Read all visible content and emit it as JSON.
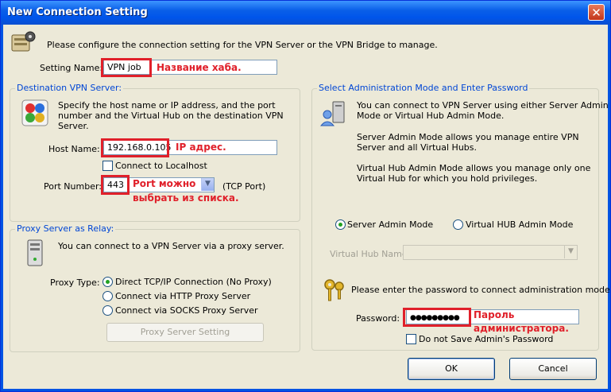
{
  "window": {
    "title": "New Connection Setting",
    "close_glyph": "✕"
  },
  "intro": {
    "text": "Please configure the connection setting for the VPN Server or the VPN Bridge to manage."
  },
  "setting_name": {
    "label": "Setting Name:",
    "value": "VPN job",
    "annotation": "Название хаба."
  },
  "destination": {
    "title": "Destination VPN Server:",
    "desc_lines": [
      "Specify the host name or IP address, and the port",
      "number and the Virtual Hub on the destination VPN",
      "Server."
    ],
    "host_label": "Host Name:",
    "host_value": "192.168.0.105",
    "host_annotation": "IP адрес.",
    "connect_localhost": "Connect to Localhost",
    "port_label": "Port Number:",
    "port_value": "443",
    "port_annotation_1": "Port можно",
    "port_annotation_2": "выбрать из списка.",
    "port_unit": "(TCP Port)"
  },
  "proxy": {
    "title": "Proxy Server as Relay:",
    "desc": "You can connect to a VPN Server via a proxy server.",
    "type_label": "Proxy Type:",
    "options": [
      "Direct TCP/IP Connection (No Proxy)",
      "Connect via HTTP Proxy Server",
      "Connect via SOCKS Proxy Server"
    ],
    "setting_button": "Proxy Server Setting"
  },
  "admin": {
    "title": "Select Administration Mode and Enter Password",
    "desc1_lines": [
      "You can connect to VPN Server using either Server Admin",
      "Mode or Virtual Hub Admin Mode."
    ],
    "desc2_lines": [
      "Server Admin Mode allows you manage entire VPN",
      "Server and all Virtual Hubs."
    ],
    "desc3_lines": [
      "Virtual Hub Admin Mode allows you manage only one",
      "Virtual Hub for which you hold privileges."
    ],
    "mode_server": "Server Admin Mode",
    "mode_hub": "Virtual HUB Admin Mode",
    "hub_name_label": "Virtual Hub Name:",
    "password_prompt": "Please enter the password to connect administration mode.",
    "password_label": "Password:",
    "password_value": "●●●●●●●●●",
    "password_annotation_1": "Пароль",
    "password_annotation_2": "администратора.",
    "do_not_save": "Do not Save Admin's Password"
  },
  "buttons": {
    "ok": "OK",
    "cancel": "Cancel"
  },
  "colors": {
    "accent": "#0046d5",
    "annotation": "#e0202a",
    "titlebar": "#0054e3"
  }
}
